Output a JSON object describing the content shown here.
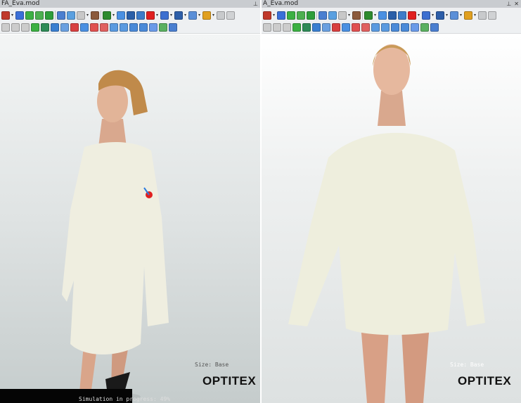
{
  "left_panel": {
    "title": "FA_Eva.mod",
    "pin_icon": "pin-icon",
    "size_label": "Size: Base",
    "logo": "OPTITEX",
    "status": "Simulation in progress: 49%",
    "progress_percent": 49
  },
  "right_panel": {
    "title": "A_Eva.mod",
    "pin_icon": "pin-icon",
    "close_icon": "close-icon",
    "size_label": "Size: Base",
    "logo": "OPTITEX"
  },
  "toolbar_row1": [
    {
      "name": "close-model-icon",
      "color": "#c0392b",
      "dd": true
    },
    {
      "name": "avatar-icon",
      "color": "#3a6fd8"
    },
    {
      "name": "refresh-icon",
      "color": "#3cb043"
    },
    {
      "name": "arrow-down-icon",
      "color": "#4caf50"
    },
    {
      "name": "play-simulation-icon",
      "color": "#2e9e3a",
      "sep": true
    },
    {
      "name": "fit-view-icon",
      "color": "#4a7fd0"
    },
    {
      "name": "frame-icon",
      "color": "#5aa0e0"
    },
    {
      "name": "disabled-frame-icon",
      "color": "#c8c8c8",
      "dd": true
    },
    {
      "name": "texture-icon",
      "color": "#8b5a3c",
      "sep": true
    },
    {
      "name": "axis-icon",
      "color": "#2e8b2e",
      "dd": true
    },
    {
      "name": "search-3d-icon",
      "color": "#4a90e2"
    },
    {
      "name": "text-icon",
      "color": "#2a5fa8"
    },
    {
      "name": "stitch-icon",
      "color": "#3d7cc9"
    },
    {
      "name": "pin-point-icon",
      "color": "#e02020",
      "dd": true
    },
    {
      "name": "avatar-settings-icon",
      "color": "#3c6fd0",
      "dd": true
    },
    {
      "name": "monitor-icon",
      "color": "#2d5ea8",
      "dd": true
    },
    {
      "name": "users-icon",
      "color": "#5a8fd8",
      "dd": true
    },
    {
      "name": "measure-avatar-icon",
      "color": "#e0a020",
      "dd": true
    },
    {
      "name": "sphere-icon",
      "color": "#c8cacc"
    },
    {
      "name": "window-icon",
      "color": "#d0d2d4"
    }
  ],
  "toolbar_row2": [
    {
      "name": "grid-split-icon",
      "color": "#ccc"
    },
    {
      "name": "grid-icon",
      "color": "#ccc"
    },
    {
      "name": "resize-icon",
      "color": "#ccc"
    },
    {
      "name": "select-icon",
      "color": "#3cb043"
    },
    {
      "name": "draw-icon",
      "color": "#2e8b57"
    },
    {
      "name": "info-icon",
      "color": "#3a7fd0"
    },
    {
      "name": "cube-view-icon",
      "color": "#6aa0e0"
    },
    {
      "name": "rotate-icon",
      "color": "#d84040"
    },
    {
      "name": "seam-icon",
      "color": "#4a90e2"
    },
    {
      "name": "front-view-icon",
      "color": "#e05050"
    },
    {
      "name": "back-view-icon",
      "color": "#e06060"
    },
    {
      "name": "left-view-icon",
      "color": "#5a9ae0"
    },
    {
      "name": "right-view-icon",
      "color": "#5a9ae0"
    },
    {
      "name": "top-view-icon",
      "color": "#4a8ad8"
    },
    {
      "name": "bottom-view-icon",
      "color": "#4a8ad8"
    },
    {
      "name": "dotted-frame-icon",
      "color": "#6a9ae8"
    },
    {
      "name": "green-frame-icon",
      "color": "#5ab060"
    },
    {
      "name": "mesh-icon",
      "color": "#4a7fd0"
    }
  ]
}
